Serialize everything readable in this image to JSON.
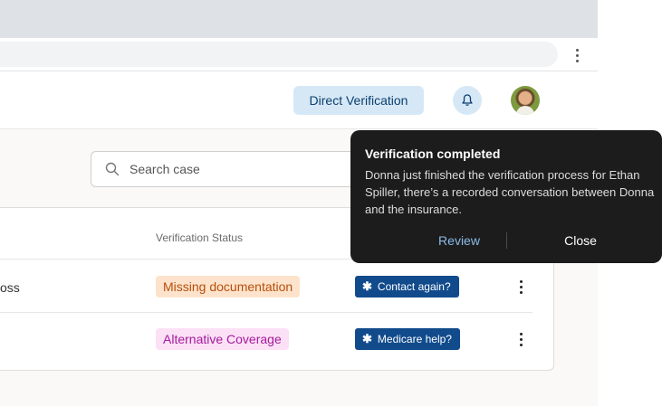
{
  "header": {
    "direct_verification_label": "Direct Verification",
    "bell_icon": "bell-icon",
    "avatar_icon": "user-avatar"
  },
  "search": {
    "placeholder": "Search case",
    "icon": "search-icon"
  },
  "table": {
    "columns": [
      "Verification Status"
    ],
    "rows": [
      {
        "name_partial": "oss",
        "status": "Missing documentation",
        "action": "Contact again?"
      },
      {
        "name_partial": "",
        "status": "Alternative Coverage",
        "action": "Medicare help?"
      }
    ]
  },
  "toast": {
    "title": "Verification completed",
    "body": "Donna just finished the verification process for Ethan Spiller, there’s a recorded conversation between Donna and the insurance.",
    "review_label": "Review",
    "close_label": "Close"
  },
  "colors": {
    "accent": "#114b8c",
    "pill_bg": "#d6e8f6",
    "missing_bg": "#fde3cb",
    "missing_text": "#b64f0c",
    "alt_bg": "#fbe0f6",
    "alt_text": "#a51b9c",
    "toast_bg": "#1c1c1c"
  }
}
